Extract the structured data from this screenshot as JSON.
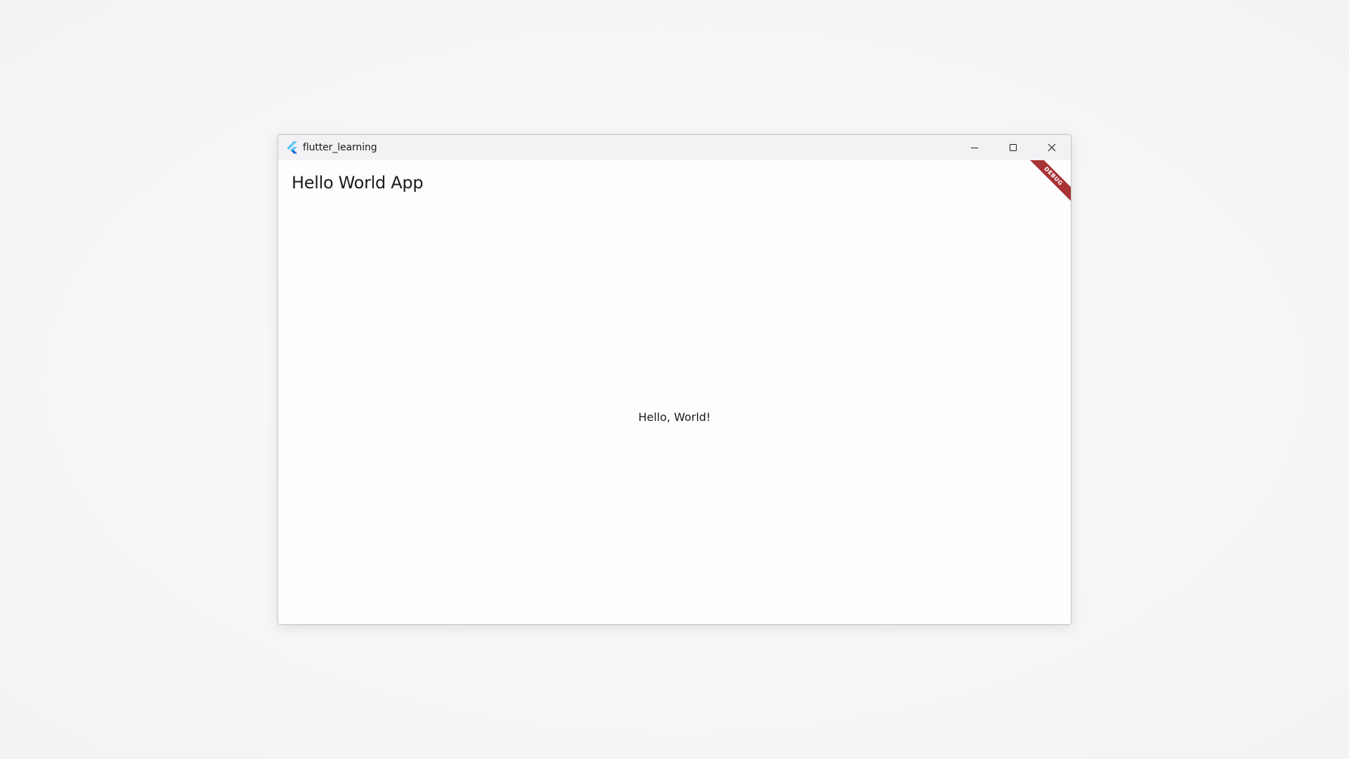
{
  "window": {
    "title": "flutter_learning",
    "app_icon": "flutter-logo-icon",
    "controls": {
      "minimize_icon": "minimize-icon",
      "maximize_icon": "maximize-icon",
      "close_icon": "close-icon"
    }
  },
  "app": {
    "appbar_title": "Hello World App",
    "body_text": "Hello, World!",
    "debug_banner": "DEBUG"
  },
  "colors": {
    "debug_banner": "#a83334",
    "flutter_light_blue": "#5ec8f8",
    "flutter_dark_blue": "#0468d7"
  }
}
